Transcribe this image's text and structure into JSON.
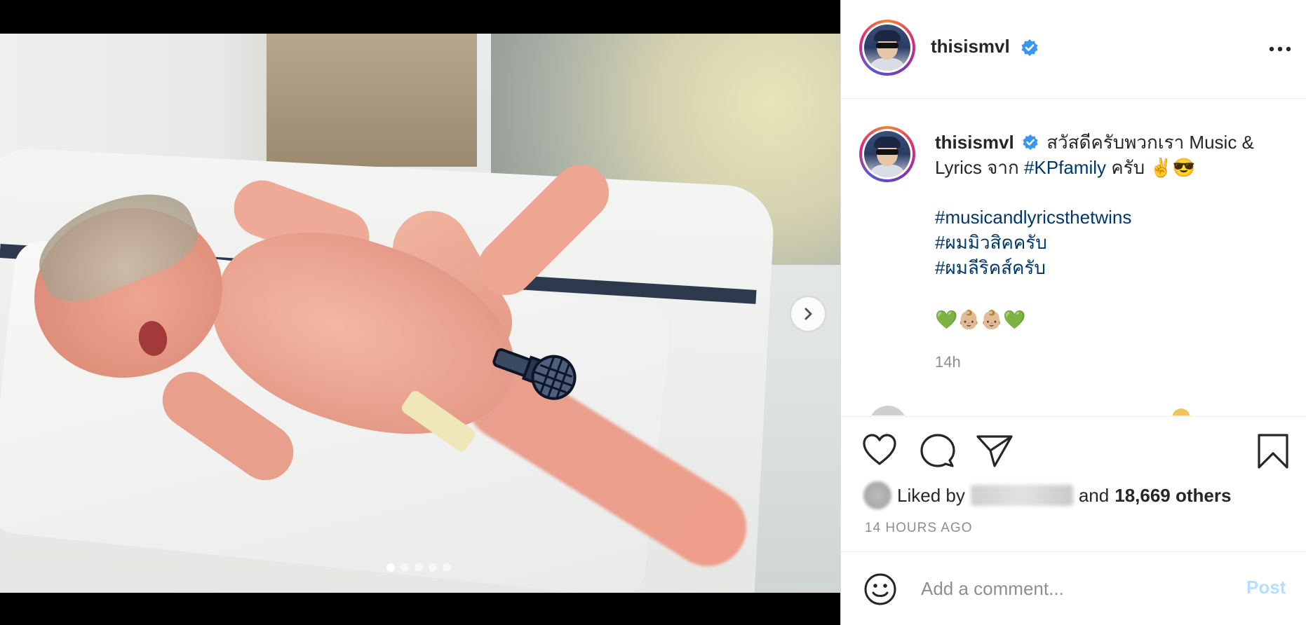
{
  "post": {
    "username": "thisismvl",
    "caption_thai_greeting": "สวัสดีครับพวกเรา Music &",
    "caption_line2_pre": "Lyrics จาก ",
    "caption_tag_kpfamily": "#KPfamily",
    "caption_line2_post": " ครับ ✌️😎",
    "hashtags": [
      "#musicandlyricsthetwins",
      "#ผมมิวสิคครับ",
      "#ผมลีริคส์ครับ"
    ],
    "emojis": "💚👶🏼👶🏼💚",
    "caption_time": "14h",
    "likes_prefix": "Liked by",
    "likes_and": "and",
    "likes_others": "18,669 others",
    "time_ago": "14 HOURS AGO"
  },
  "carousel": {
    "total_slides": 5,
    "active_index": 0
  },
  "comment": {
    "placeholder": "Add a comment...",
    "post_label": "Post"
  },
  "icons": {
    "verified": "verified-badge-icon",
    "more": "more-options-icon",
    "like": "heart-icon",
    "comment": "comment-bubble-icon",
    "share": "paper-plane-icon",
    "save": "bookmark-icon",
    "emoji": "smiley-icon",
    "next": "chevron-right-icon"
  },
  "colors": {
    "verified_blue": "#3897f0",
    "hashtag": "#00376b",
    "post_disabled": "#b2dffc",
    "muted": "#8e8e8e"
  }
}
